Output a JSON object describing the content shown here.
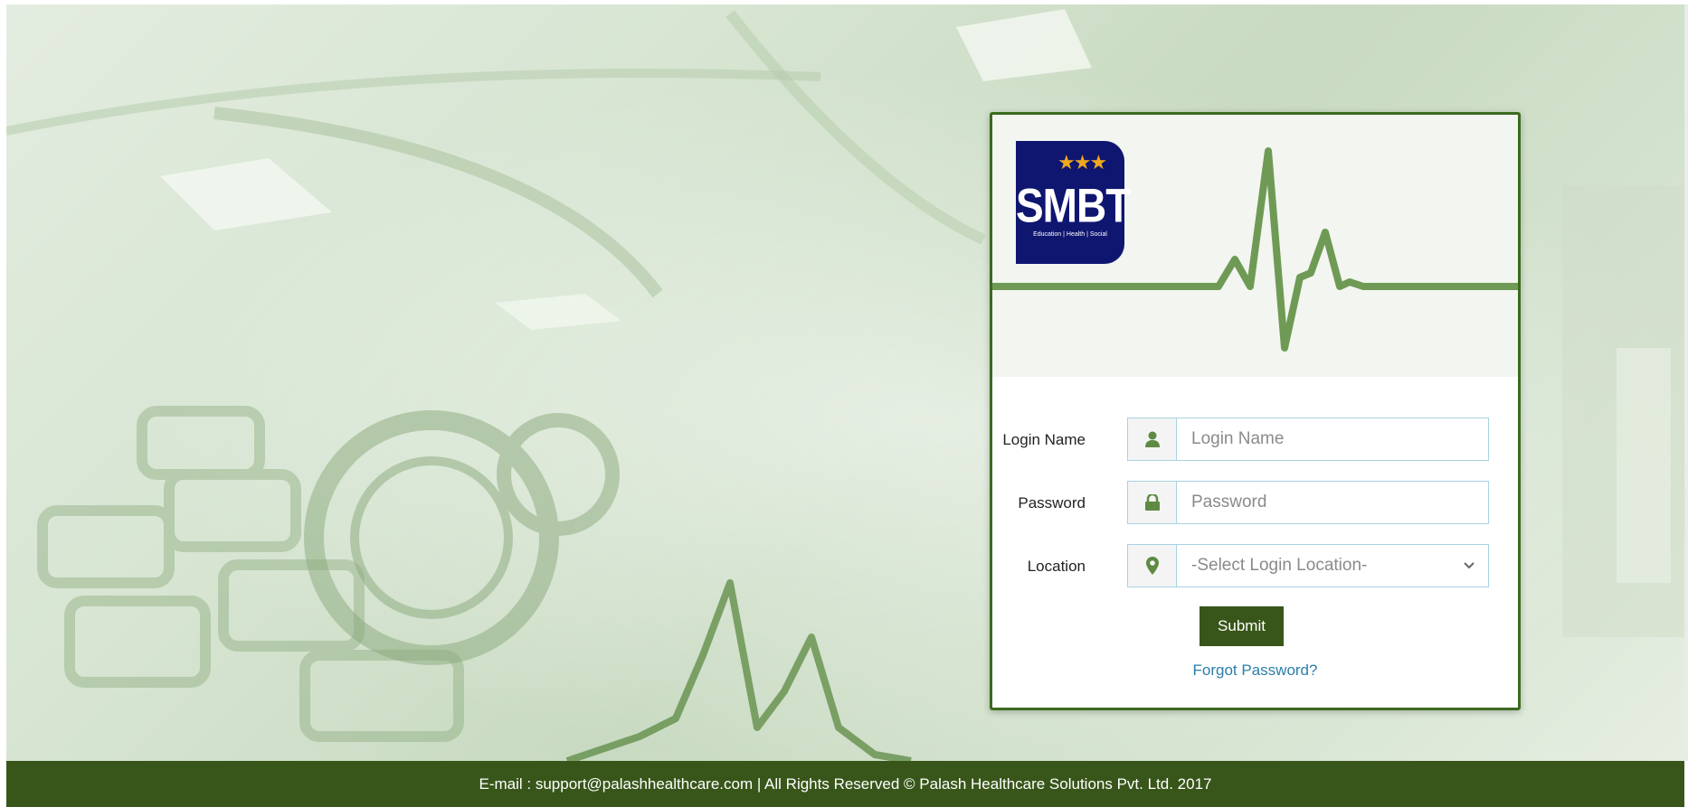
{
  "logo": {
    "stars": "★★★",
    "mark": "SMBT",
    "tagline": "Education | Health | Social"
  },
  "form": {
    "login_name": {
      "label": "Login Name",
      "placeholder": "Login Name",
      "value": "",
      "icon": "user-icon"
    },
    "password": {
      "label": "Password",
      "placeholder": "Password",
      "value": "",
      "icon": "lock-icon"
    },
    "location": {
      "label": "Location",
      "selected": "-Select Login Location-",
      "icon": "map-marker-icon"
    },
    "submit_label": "Submit",
    "forgot_label": "Forgot Password?"
  },
  "footer": {
    "text": "E-mail : support@palashhealthcare.com | All Rights Reserved © Palash Healthcare Solutions Pvt. Ltd. 2017"
  },
  "colors": {
    "brand_green": "#38561a",
    "card_border": "#3b6a1e",
    "ecg_green": "#6f9a55",
    "logo_navy": "#0f1670",
    "logo_star": "#f0a81e",
    "link": "#2a7ea8",
    "input_border": "#a9d2e2"
  }
}
